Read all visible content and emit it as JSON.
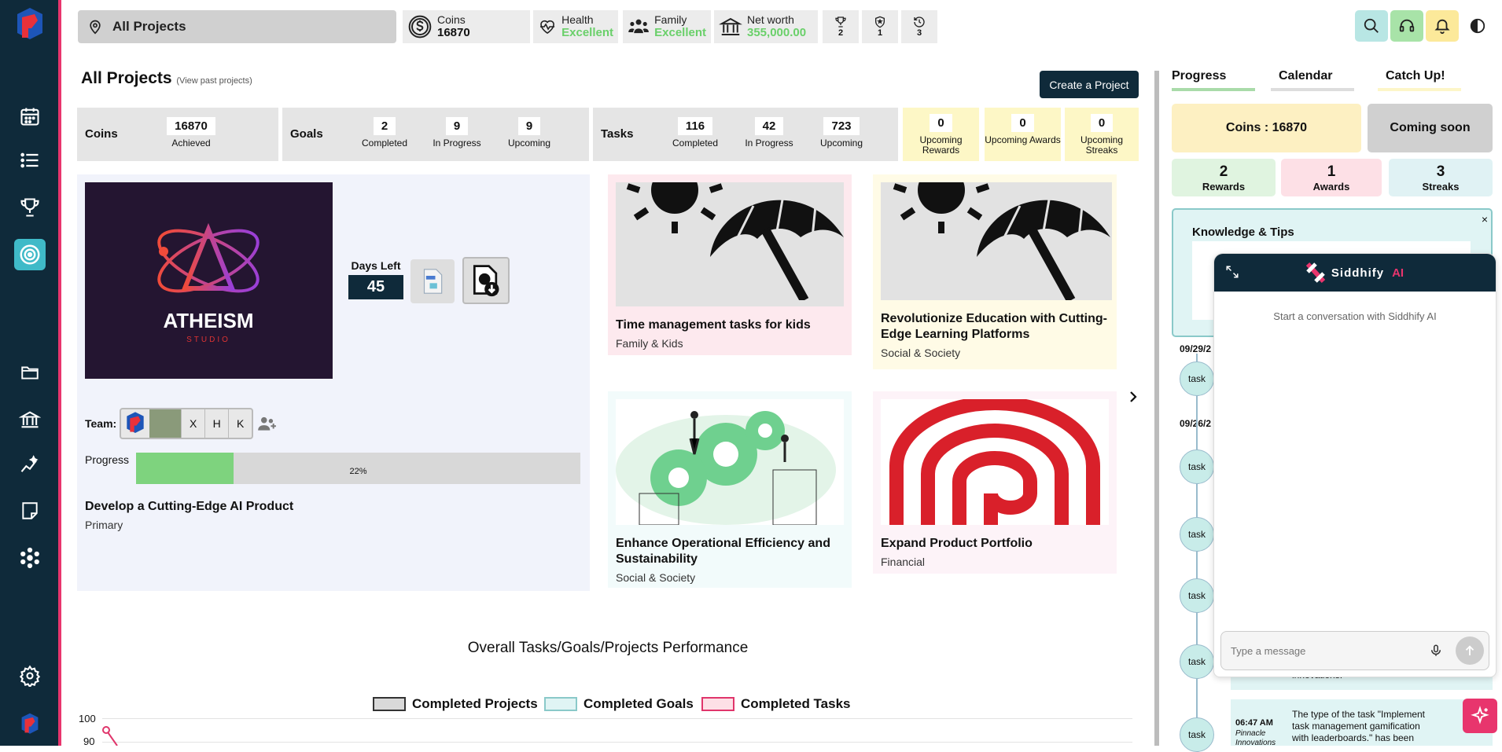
{
  "topbar": {
    "location": "All Projects",
    "coins_label": "Coins",
    "coins_value": "16870",
    "health_label": "Health",
    "health_value": "Excellent",
    "family_label": "Family",
    "family_value": "Excellent",
    "networth_label": "Net worth",
    "networth_value": "355,000.00",
    "trophy_count": "2",
    "badge_count": "1",
    "history_count": "3"
  },
  "page": {
    "title": "All Projects",
    "subtitle": "(View past projects)",
    "create_button": "Create a Project"
  },
  "stats": {
    "coins": {
      "title": "Coins",
      "value": "16870",
      "label": "Achieved"
    },
    "goals": {
      "title": "Goals",
      "items": [
        {
          "value": "2",
          "label": "Completed"
        },
        {
          "value": "9",
          "label": "In Progress"
        },
        {
          "value": "9",
          "label": "Upcoming"
        }
      ]
    },
    "tasks": {
      "title": "Tasks",
      "items": [
        {
          "value": "116",
          "label": "Completed"
        },
        {
          "value": "42",
          "label": "In Progress"
        },
        {
          "value": "723",
          "label": "Upcoming"
        }
      ]
    },
    "upcoming": [
      {
        "value": "0",
        "label": "Upcoming Rewards"
      },
      {
        "value": "0",
        "label": "Upcoming Awards"
      },
      {
        "value": "0",
        "label": "Upcoming Streaks"
      }
    ]
  },
  "featured": {
    "logo_text": "ATHEISM",
    "logo_sub": "STUDIO",
    "days_left_label": "Days Left",
    "days_left": "45",
    "team_label": "Team:",
    "team_members": [
      "X",
      "H",
      "K"
    ],
    "progress_label": "Progress",
    "progress_value": 22,
    "progress_text": "22%",
    "title": "Develop a Cutting-Edge AI Product",
    "category": "Primary"
  },
  "projects": [
    {
      "title": "Time management tasks for kids",
      "category": "Family & Kids",
      "bg": "#fde9ee"
    },
    {
      "title": "Revolutionize Education with Cutting-Edge Learning Platforms",
      "category": "Social & Society",
      "bg": "#fffbe6"
    },
    {
      "title": "Enhance Operational Efficiency and Sustainability",
      "category": "Social & Society",
      "bg": "#f2fbfb"
    },
    {
      "title": "Expand Product Portfolio",
      "category": "Financial",
      "bg": "#fdf3f8"
    }
  ],
  "right_panel": {
    "tabs": [
      {
        "label": "Progress",
        "accent": "#a9dba9"
      },
      {
        "label": "Calendar",
        "accent": "#dddddd"
      },
      {
        "label": "Catch Up!",
        "accent": "#fdf6c8"
      }
    ],
    "coins_box": "Coins : 16870",
    "coming_soon": "Coming soon",
    "rewards": {
      "value": "2",
      "label": "Rewards"
    },
    "awards": {
      "value": "1",
      "label": "Awards"
    },
    "streaks": {
      "value": "3",
      "label": "Streaks"
    },
    "knowledge_title": "Knowledge & Tips",
    "dates": [
      "09/29/2",
      "09/26/2"
    ],
    "timeline_label": "task",
    "timeline_text_1": "innovations.",
    "timeline_time": "06:47 AM",
    "timeline_company": "Pinnacle Innovations",
    "timeline_text_2": "The type of the task \"Implement task management gamification with leaderboards.\" has been updated by"
  },
  "chat": {
    "brand": "Siddhify",
    "ai_badge": "AI",
    "intro": "Start a conversation with Siddhify AI",
    "placeholder": "Type a message"
  },
  "chart_data": {
    "type": "line",
    "title": "Overall Tasks/Goals/Projects Performance",
    "series": [
      {
        "name": "Completed Projects",
        "color": "#d9d9d9",
        "stroke": "#333333"
      },
      {
        "name": "Completed Goals",
        "color": "#e0f4f4",
        "stroke": "#8ac9c9"
      },
      {
        "name": "Completed Tasks",
        "color": "#fde0e6",
        "stroke": "#e0356b"
      }
    ],
    "y_ticks": [
      "100",
      "90"
    ],
    "visible_points": [
      {
        "series": "Completed Tasks",
        "y": 100
      }
    ]
  }
}
